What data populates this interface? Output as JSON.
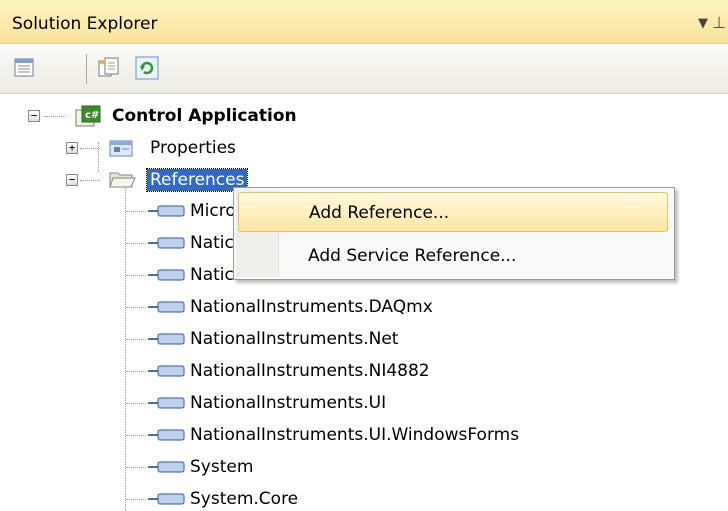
{
  "panel": {
    "title": "Solution Explorer",
    "dropdown_glyph": "▼",
    "pin_glyph": "⊥"
  },
  "toolbar": {
    "buttons": [
      {
        "icon": "properties-icon"
      },
      {
        "icon": "show-all-files-icon"
      },
      {
        "icon": "refresh-icon"
      }
    ]
  },
  "tree": {
    "project": {
      "label": "Control Application",
      "icon": "csharp-project-icon",
      "expanded": true
    },
    "properties": {
      "label": "Properties",
      "icon": "properties-folder-icon",
      "expanded": false
    },
    "references": {
      "label": "References",
      "icon": "folder-open-icon",
      "expanded": true,
      "selected": true
    },
    "items": [
      "Micro",
      "Natic",
      "Natic",
      "NationalInstruments.DAQmx",
      "NationalInstruments.Net",
      "NationalInstruments.NI4882",
      "NationalInstruments.UI",
      "NationalInstruments.UI.WindowsForms",
      "System",
      "System.Core"
    ],
    "expander_collapsed": "+",
    "expander_expanded": "−"
  },
  "context_menu": {
    "items": [
      {
        "label": "Add Reference...",
        "highlighted": true
      },
      {
        "label": "Add Service Reference...",
        "highlighted": false
      }
    ]
  },
  "colors": {
    "titlebar": "#f8e39a",
    "selection": "#316ac5",
    "menu_highlight": "#fbe6a5"
  }
}
